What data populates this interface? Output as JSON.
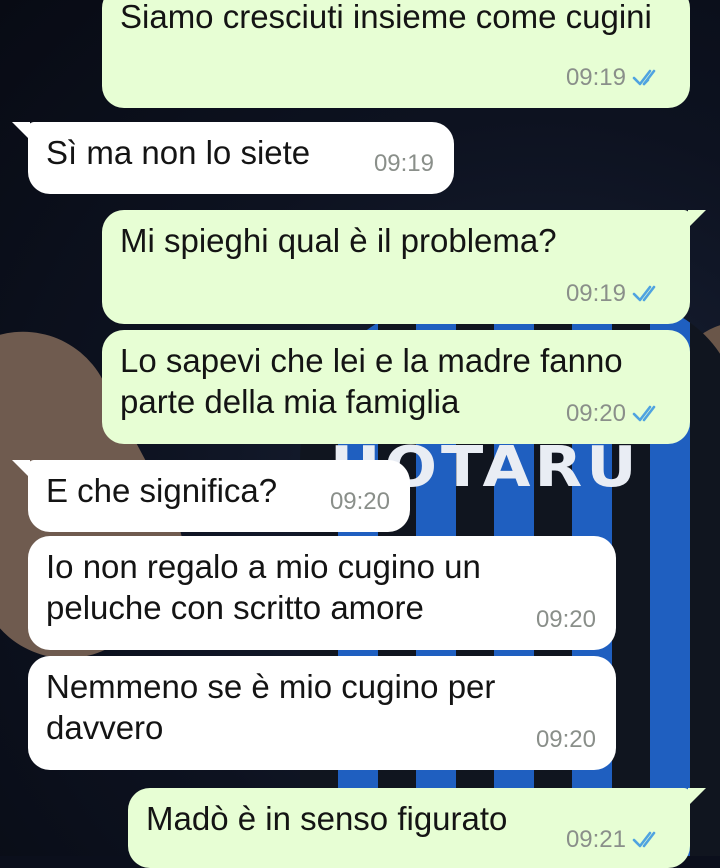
{
  "chat": {
    "messages": [
      {
        "direction": "out",
        "text": "Siamo cresciuti insieme come cugini",
        "time": "09:19",
        "read": true
      },
      {
        "direction": "in",
        "text": "Sì ma non lo siete",
        "time": "09:19"
      },
      {
        "direction": "out",
        "text": "Mi spieghi qual è il problema?",
        "time": "09:19",
        "read": true
      },
      {
        "direction": "out",
        "text": "Lo sapevi che lei e la madre fanno parte della mia famiglia",
        "time": "09:20",
        "read": true
      },
      {
        "direction": "in",
        "text": "E che significa?",
        "time": "09:20"
      },
      {
        "direction": "in",
        "text": "Io non regalo a mio cugino un peluche con scritto amore",
        "time": "09:20"
      },
      {
        "direction": "in",
        "text": "Nemmeno se è mio cugino per davvero",
        "time": "09:20"
      },
      {
        "direction": "out",
        "text": "Madò è in senso figurato",
        "time": "09:21",
        "read": true
      }
    ]
  },
  "wallpaper": {
    "jersey_text": "UOTARU"
  },
  "colors": {
    "outgoing_bubble": "#e7fed4",
    "incoming_bubble": "#ffffff",
    "read_ticks": "#4fa3e0",
    "timestamp": "#8a8f8a"
  },
  "icons": {
    "read_receipt": "double-check-icon"
  }
}
